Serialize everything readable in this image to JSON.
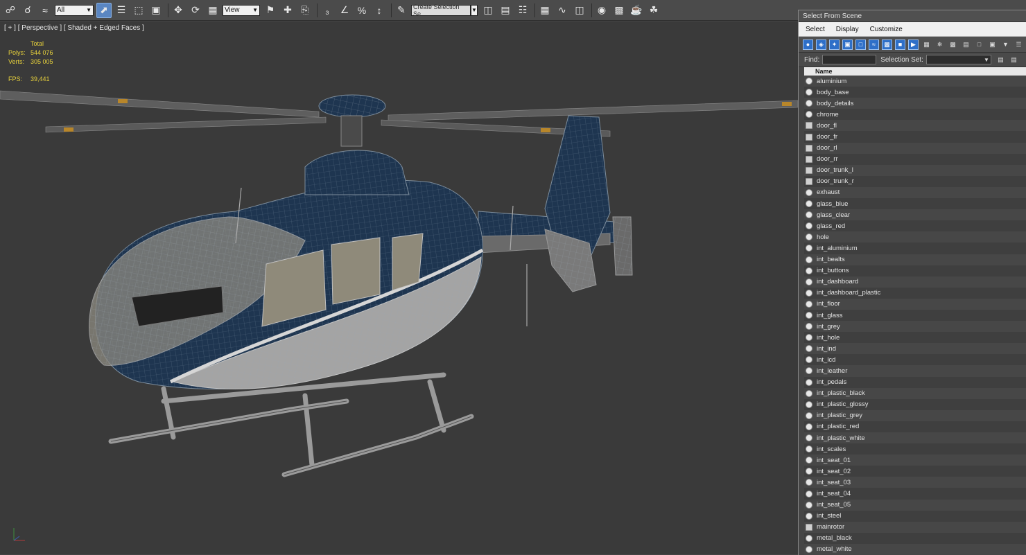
{
  "toolbar": {
    "filter_select": "All",
    "ref_coord_select": "View",
    "selection_set_placeholder": "Create Selection Se"
  },
  "viewport": {
    "label": "[ + ] [ Perspective ] [ Shaded + Edged Faces ]",
    "stats": {
      "header": "Total",
      "polys_label": "Polys:",
      "polys_value": "544 076",
      "verts_label": "Verts:",
      "verts_value": "305 005",
      "fps_label": "FPS:",
      "fps_value": "39,441"
    },
    "model": {
      "body_color": "#1e3550",
      "belly_color": "#a8a8a8",
      "wire_color": "#9aa6b0"
    }
  },
  "panel": {
    "title": "Select From Scene",
    "menu": [
      "Select",
      "Display",
      "Customize"
    ],
    "find_label": "Find:",
    "selection_set_label": "Selection Set:",
    "column_name": "Name",
    "items": [
      {
        "name": "aluminium",
        "type": "object"
      },
      {
        "name": "body_base",
        "type": "object"
      },
      {
        "name": "body_details",
        "type": "object"
      },
      {
        "name": "chrome",
        "type": "object"
      },
      {
        "name": "door_fl",
        "type": "group"
      },
      {
        "name": "door_fr",
        "type": "group"
      },
      {
        "name": "door_rl",
        "type": "group"
      },
      {
        "name": "door_rr",
        "type": "group"
      },
      {
        "name": "door_trunk_l",
        "type": "group"
      },
      {
        "name": "door_trunk_r",
        "type": "group"
      },
      {
        "name": "exhaust",
        "type": "object"
      },
      {
        "name": "glass_blue",
        "type": "object"
      },
      {
        "name": "glass_clear",
        "type": "object"
      },
      {
        "name": "glass_red",
        "type": "object"
      },
      {
        "name": "hole",
        "type": "object"
      },
      {
        "name": "int_aluminium",
        "type": "object"
      },
      {
        "name": "int_bealts",
        "type": "object"
      },
      {
        "name": "int_buttons",
        "type": "object"
      },
      {
        "name": "int_dashboard",
        "type": "object"
      },
      {
        "name": "int_dashboard_plastic",
        "type": "object"
      },
      {
        "name": "int_floor",
        "type": "object"
      },
      {
        "name": "int_glass",
        "type": "object"
      },
      {
        "name": "int_grey",
        "type": "object"
      },
      {
        "name": "int_hole",
        "type": "object"
      },
      {
        "name": "int_ind",
        "type": "object"
      },
      {
        "name": "int_lcd",
        "type": "object"
      },
      {
        "name": "int_leather",
        "type": "object"
      },
      {
        "name": "int_pedals",
        "type": "object"
      },
      {
        "name": "int_plastic_black",
        "type": "object"
      },
      {
        "name": "int_plastic_glossy",
        "type": "object"
      },
      {
        "name": "int_plastic_grey",
        "type": "object"
      },
      {
        "name": "int_plastic_red",
        "type": "object"
      },
      {
        "name": "int_plastic_white",
        "type": "object"
      },
      {
        "name": "int_scales",
        "type": "object"
      },
      {
        "name": "int_seat_01",
        "type": "object"
      },
      {
        "name": "int_seat_02",
        "type": "object"
      },
      {
        "name": "int_seat_03",
        "type": "object"
      },
      {
        "name": "int_seat_04",
        "type": "object"
      },
      {
        "name": "int_seat_05",
        "type": "object"
      },
      {
        "name": "int_steel",
        "type": "object"
      },
      {
        "name": "mainrotor",
        "type": "group"
      },
      {
        "name": "metal_black",
        "type": "object"
      },
      {
        "name": "metal_white",
        "type": "object"
      }
    ]
  }
}
